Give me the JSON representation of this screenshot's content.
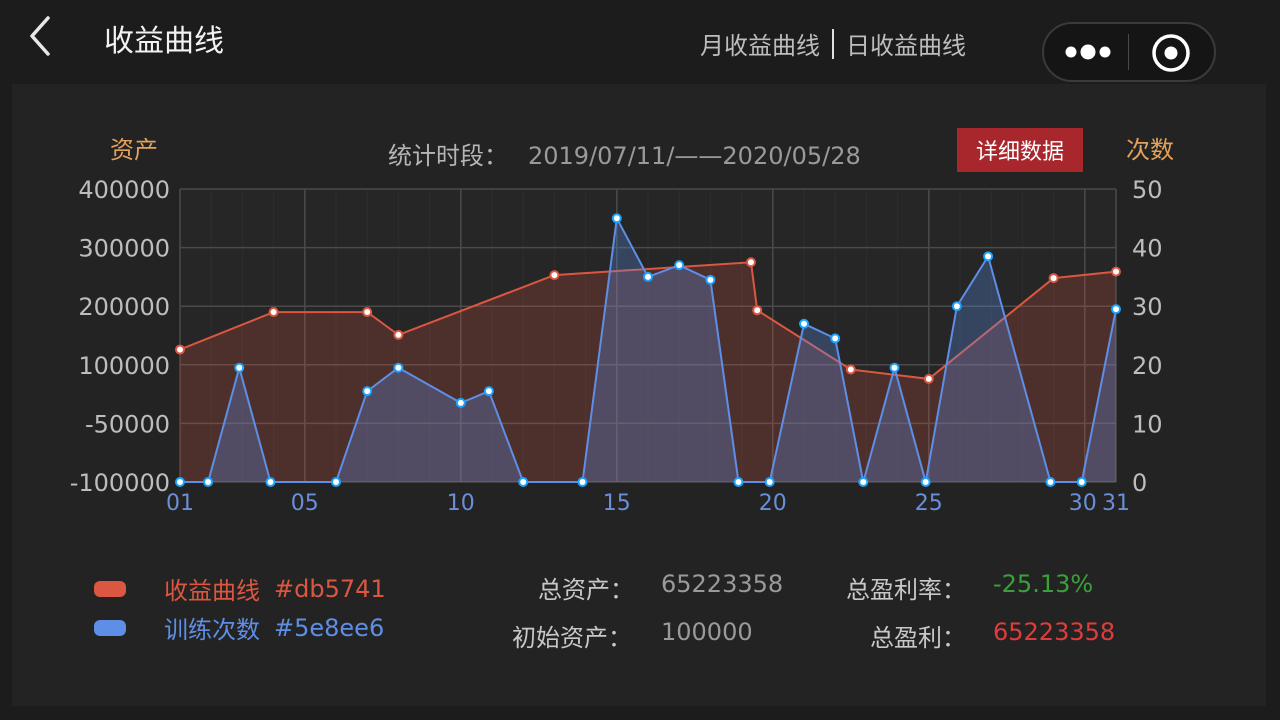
{
  "header": {
    "title": "收益曲线",
    "switch_month": "月收益曲线",
    "switch_day": "日收益曲线"
  },
  "chart_panel": {
    "left_axis_title": "资产",
    "right_axis_title": "次数",
    "period_label": "统计时段：",
    "period_value": "2019/07/11/——2020/05/28",
    "detail_button": "详细数据"
  },
  "legend": [
    {
      "label": "收益曲线",
      "code": "#db5741",
      "color": "#db5741"
    },
    {
      "label": "训练次数",
      "code": "#5e8ee6",
      "color": "#5e8ee6"
    }
  ],
  "stats": {
    "total_assets_label": "总资产：",
    "total_assets_value": "65223358",
    "initial_assets_label": "初始资产：",
    "initial_assets_value": "100000",
    "profit_rate_label": "总盈利率：",
    "profit_rate_value": "-25.13%",
    "profit_rate_color": "#3aa03a",
    "total_profit_label": "总盈利：",
    "total_profit_value": "65223358",
    "total_profit_color": "#e03c3c"
  },
  "chart_data": {
    "type": "area",
    "x_tick_labels": [
      "01",
      "05",
      "10",
      "15",
      "20",
      "25",
      "30",
      "31"
    ],
    "x_range": [
      1,
      31
    ],
    "left_axis": {
      "ticks": [
        "400000",
        "300000",
        "200000",
        "100000",
        "-50000",
        "-100000"
      ]
    },
    "right_axis": {
      "ticks": [
        "50",
        "40",
        "30",
        "20",
        "10",
        "0"
      ],
      "range": [
        0,
        50
      ]
    },
    "grid": true,
    "series": [
      {
        "name": "收益曲线",
        "color": "#db5741",
        "axis": "left",
        "x": [
          1,
          4,
          7,
          8,
          13,
          19.3,
          19.5,
          22.5,
          25,
          29,
          31
        ],
        "values": [
          126000,
          190000,
          190000,
          151000,
          253000,
          275000,
          193000,
          88000,
          64000,
          248000,
          259000
        ]
      },
      {
        "name": "训练次数",
        "color": "#5e8ee6",
        "axis": "right",
        "x": [
          1,
          1.9,
          2.9,
          3.9,
          6,
          7,
          8,
          10,
          10.9,
          12,
          13.9,
          15,
          16,
          17,
          18,
          18.9,
          19.9,
          21,
          22,
          22.9,
          23.9,
          24.9,
          25.9,
          26.9,
          28.9,
          29.9,
          31
        ],
        "values": [
          0,
          0,
          19.5,
          0,
          0,
          15.5,
          19.5,
          13.5,
          15.5,
          0,
          0,
          45,
          35,
          37,
          34.5,
          0,
          0,
          27,
          24.5,
          0,
          19.5,
          0,
          30,
          38.5,
          0,
          0,
          29.5
        ]
      }
    ]
  }
}
